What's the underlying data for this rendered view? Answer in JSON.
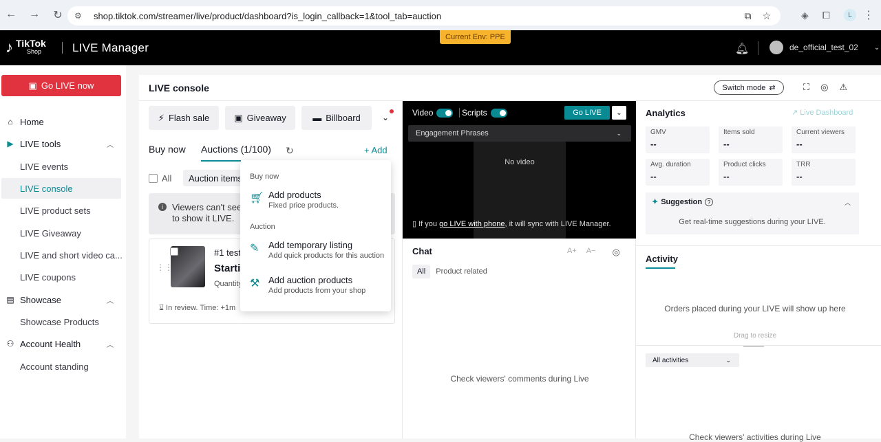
{
  "browser": {
    "url": "shop.tiktok.com/streamer/live/product/dashboard?is_login_callback=1&tool_tab=auction",
    "profile_initial": "L"
  },
  "header": {
    "brand_top": "TikTok",
    "brand_sub": "Shop",
    "title": "LIVE Manager",
    "env_badge": "Current Env: PPE",
    "username": "de_official_test_02"
  },
  "sidebar": {
    "go_live": "Go LIVE now",
    "home": "Home",
    "live_tools": "LIVE tools",
    "live_events": "LIVE events",
    "live_console": "LIVE console",
    "live_product_sets": "LIVE product sets",
    "live_giveaway": "LIVE Giveaway",
    "live_short_video": "LIVE and short video ca...",
    "live_coupons": "LIVE coupons",
    "showcase": "Showcase",
    "showcase_products": "Showcase Products",
    "account_health": "Account Health",
    "account_standing": "Account standing"
  },
  "console": {
    "title": "LIVE console",
    "switch_mode": "Switch mode",
    "flash_sale": "Flash sale",
    "giveaway": "Giveaway",
    "billboard": "Billboard",
    "tab_buy_now": "Buy now",
    "tab_auctions": "Auctions (1/100)",
    "add": "+ Add",
    "all": "All",
    "auction_items": "Auction items",
    "info_line1": "Viewers can't see",
    "info_line2": "to show it LIVE.",
    "product_name": "#1 test",
    "product_start": "Startir",
    "product_qty": "Quantity",
    "product_status": "In review. Time: +1m"
  },
  "dropdown": {
    "buy_now": "Buy now",
    "add_products": "Add products",
    "add_products_desc": "Fixed price products.",
    "auction": "Auction",
    "add_temp": "Add temporary listing",
    "add_temp_desc": "Add quick products for this auction",
    "add_auction": "Add auction products",
    "add_auction_desc": "Add products from your shop"
  },
  "video": {
    "video_label": "Video",
    "scripts_label": "Scripts",
    "go_live": "Go LIVE",
    "engagement": "Engagement Phrases",
    "no_video": "No video",
    "phone_pre": "If you ",
    "phone_link": "go LIVE with phone",
    "phone_post": ", it will sync with LIVE Manager."
  },
  "chat": {
    "title": "Chat",
    "filter_all": "All",
    "filter_product": "Product related",
    "empty": "Check viewers' comments during Live"
  },
  "analytics": {
    "title": "Analytics",
    "dashboard_link": "Live Dashboard",
    "metrics": [
      {
        "label": "GMV",
        "value": "--"
      },
      {
        "label": "Items sold",
        "value": "--"
      },
      {
        "label": "Current viewers",
        "value": "--"
      },
      {
        "label": "Avg. duration",
        "value": "--"
      },
      {
        "label": "Product clicks",
        "value": "--"
      },
      {
        "label": "TRR",
        "value": "--"
      }
    ],
    "suggestion_title": "Suggestion",
    "suggestion_body": "Get real-time suggestions during your LIVE."
  },
  "activity": {
    "title": "Activity",
    "empty": "Orders placed during your LIVE will show up here",
    "drag": "Drag to resize",
    "filter": "All activities",
    "empty2": "Check viewers' activities during Live"
  }
}
